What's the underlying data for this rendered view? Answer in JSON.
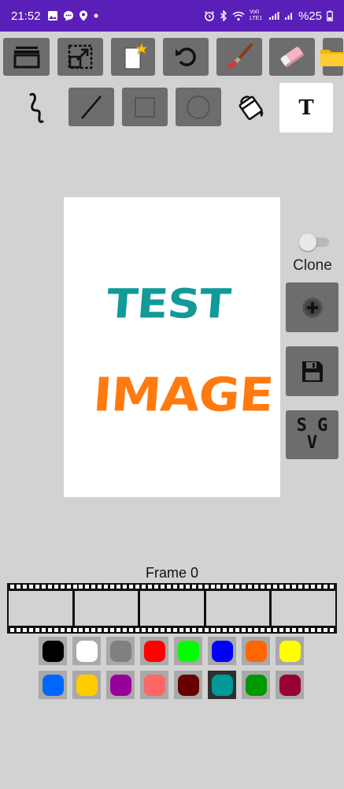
{
  "status_bar": {
    "time": "21:52",
    "battery": "%25",
    "network": "Vo0 LTE1"
  },
  "toolbar_row1": [
    {
      "name": "layers-button",
      "icon": "layers-icon"
    },
    {
      "name": "resize-button",
      "icon": "resize-icon"
    },
    {
      "name": "new-page-button",
      "icon": "new-page-icon"
    },
    {
      "name": "undo-button",
      "icon": "undo-icon"
    },
    {
      "name": "brush-button",
      "icon": "brush-icon"
    },
    {
      "name": "eraser-button",
      "icon": "eraser-icon"
    },
    {
      "name": "folder-button",
      "icon": "folder-icon"
    }
  ],
  "toolbar_row2": [
    {
      "name": "freehand-tool",
      "icon": "squiggle-icon"
    },
    {
      "name": "line-tool",
      "icon": "line-icon"
    },
    {
      "name": "rectangle-tool",
      "icon": "square-icon"
    },
    {
      "name": "circle-tool",
      "icon": "circle-icon"
    },
    {
      "name": "fill-tool",
      "icon": "paint-bucket-icon"
    },
    {
      "name": "text-tool",
      "icon": "text-icon",
      "label": "T"
    }
  ],
  "canvas": {
    "line1": "TEST",
    "line2": "IMAGE",
    "line1_color": "#119a9a",
    "line2_color": "#ff7a10"
  },
  "side_panel": {
    "clone_label": "Clone",
    "clone_on": false,
    "add_icon": "plus-icon",
    "save_icon": "floppy-disk-icon",
    "svg_label_top": "S G",
    "svg_label_bottom": "V"
  },
  "timeline": {
    "frame_label": "Frame 0",
    "frame_count": 5
  },
  "palette": {
    "row1": [
      "#000000",
      "#ffffff",
      "#808080",
      "#ff0000",
      "#00ff00",
      "#0000ff",
      "#ff6600",
      "#ffff00"
    ],
    "row2": [
      "#0066ff",
      "#ffcc00",
      "#990099",
      "#ff6666",
      "#660000",
      "#009999",
      "#009900",
      "#990033"
    ],
    "selected": "#009999"
  }
}
